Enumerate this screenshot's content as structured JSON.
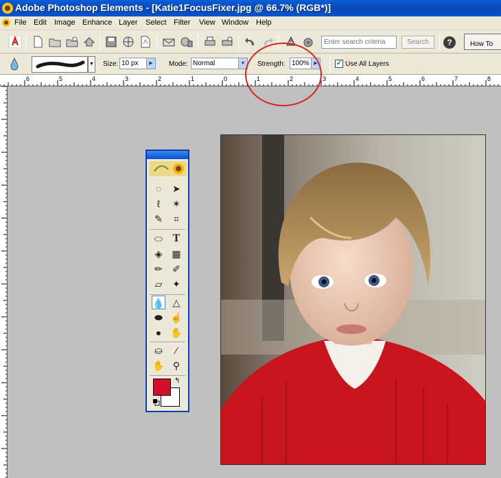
{
  "window": {
    "title": "Adobe Photoshop Elements - [Katie1FocusFixer.jpg @ 66.7% (RGB*)]"
  },
  "menubar": {
    "items": [
      "File",
      "Edit",
      "Image",
      "Enhance",
      "Layer",
      "Select",
      "Filter",
      "View",
      "Window",
      "Help"
    ]
  },
  "shortcuts": {
    "search_placeholder": "Enter search criteria",
    "search_button": "Search",
    "help_glyph": "?",
    "how_to_label": "How To"
  },
  "options": {
    "size_label": "Size:",
    "size_value": "10 px",
    "mode_label": "Mode:",
    "mode_value": "Normal",
    "strength_label": "Strength:",
    "strength_value": "100%",
    "use_all_layers_label": "Use All Layers",
    "use_all_layers_checked": true
  },
  "ruler": {
    "horizontal_labels": [
      "6",
      "5",
      "4",
      "3",
      "2",
      "1",
      "0",
      "1",
      "2",
      "3",
      "4",
      "5",
      "6",
      "7",
      "8"
    ]
  },
  "toolbox": {
    "type_tool_glyph": "T",
    "foreground_color": "#d5102c",
    "background_color": "#ffffff"
  },
  "colors": {
    "titlebar_blue": "#0a5fd8",
    "annotation_red": "#d8261f",
    "ui_gray": "#ece9d8",
    "canvas_gray": "#c0c0c0"
  }
}
